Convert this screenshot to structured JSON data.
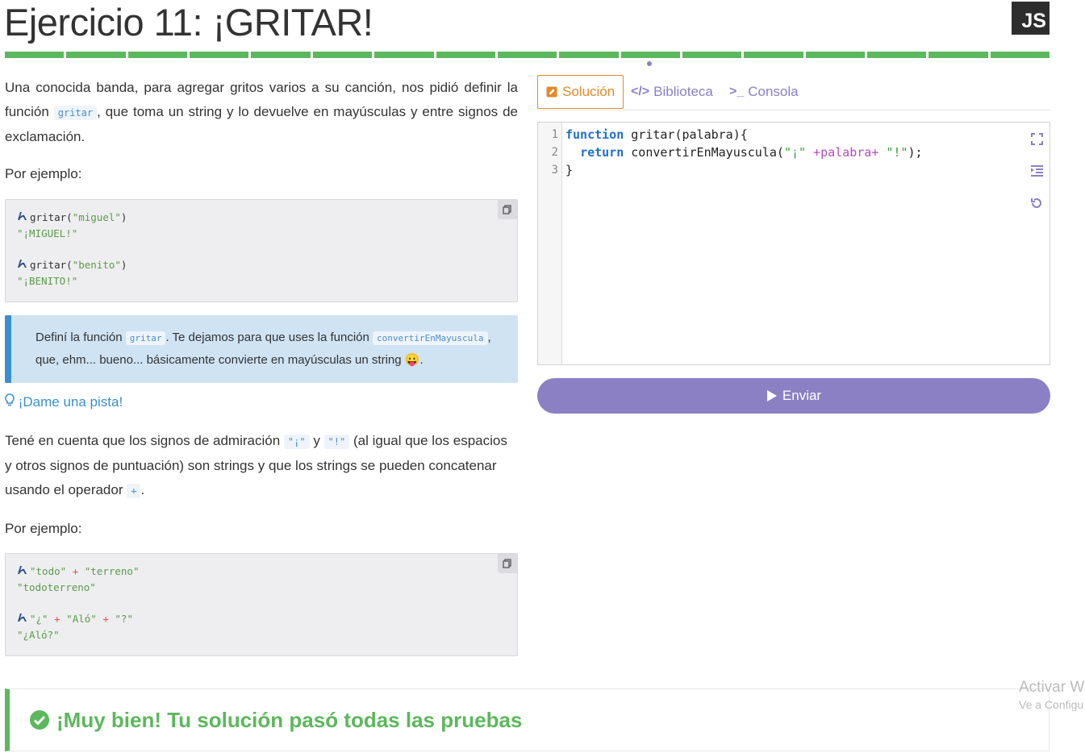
{
  "header": {
    "title": "Ejercicio 11: ¡GRITAR!",
    "language_badge": "JS"
  },
  "progress": {
    "total_segments": 17,
    "completed_segments": 17,
    "current_index": 10
  },
  "left": {
    "intro_before": "Una conocida banda, para agregar gritos varios a su canción, nos pidió definir la función ",
    "intro_code": "gritar",
    "intro_after": ", que toma un string y lo devuelve en mayúsculas y entre signos de exclamación.",
    "example_label": "Por ejemplo:",
    "example1": {
      "lines": [
        {
          "call_fn": "gritar(",
          "arg": "\"miguel\"",
          "close": ")",
          "result": "\"¡MIGUEL!\""
        },
        {
          "call_fn": "gritar(",
          "arg": "\"benito\"",
          "close": ")",
          "result": "\"¡BENITO!\""
        }
      ]
    },
    "tip": {
      "text1": "Definí la función ",
      "code1": "gritar",
      "text2": ". Te dejamos para que uses la función ",
      "code2": "convertirEnMayuscula",
      "text3": ",",
      "text4": "que, ehm... bueno... básicamente convierte en mayúsculas un string ",
      "emoji": "😛",
      "text5": "."
    },
    "hint_label": "¡Dame una pista!",
    "hint_p1": "Tené en cuenta que los signos de admiración ",
    "hint_code1": "\"¡\"",
    "hint_p2": " y ",
    "hint_code2": "\"!\"",
    "hint_p3": " (al igual que los espacios y otros signos de puntuación) son strings y que los strings se pueden concatenar usando el operador ",
    "hint_code3": "+",
    "hint_p4": ".",
    "example_label2": "Por ejemplo:",
    "example2": {
      "lines": [
        {
          "a": "\"todo\"",
          "op": "+",
          "b": "\"terreno\"",
          "result": "\"todoterreno\""
        },
        {
          "a": "\"¿\"",
          "op": "+",
          "b": "\"Aló\"",
          "op2": "+",
          "c": "\"?\"",
          "result": "\"¿Aló?\""
        }
      ]
    }
  },
  "tabs": [
    {
      "label": "Solución",
      "icon": "edit-icon",
      "active": true
    },
    {
      "label": "Biblioteca",
      "icon": "code-icon",
      "active": false
    },
    {
      "label": "Consola",
      "icon": "terminal-icon",
      "active": false
    }
  ],
  "editor": {
    "line_numbers": [
      "1",
      "2",
      "3"
    ],
    "code": {
      "l1_kw": "function",
      "l1_rest": " gritar(palabra){",
      "l2_indent": "  ",
      "l2_kw": "return",
      "l2_fn": " convertirEnMayuscula(",
      "l2_s1": "\"¡\"",
      "l2_op1": " +",
      "l2_mid": "palabra",
      "l2_op2": "+",
      "l2_s2": " \"!\"",
      "l2_end": ");",
      "l3": "}"
    }
  },
  "submit_label": "Enviar",
  "success_message": "¡Muy bien! Tu solución pasó todas las pruebas",
  "watermark": {
    "title": "Activar W",
    "subtitle": "Ve a Configu"
  },
  "colors": {
    "green": "#5cb85c",
    "purple": "#8b80c4",
    "orange": "#e28a2b",
    "blue": "#3a8fd1"
  }
}
